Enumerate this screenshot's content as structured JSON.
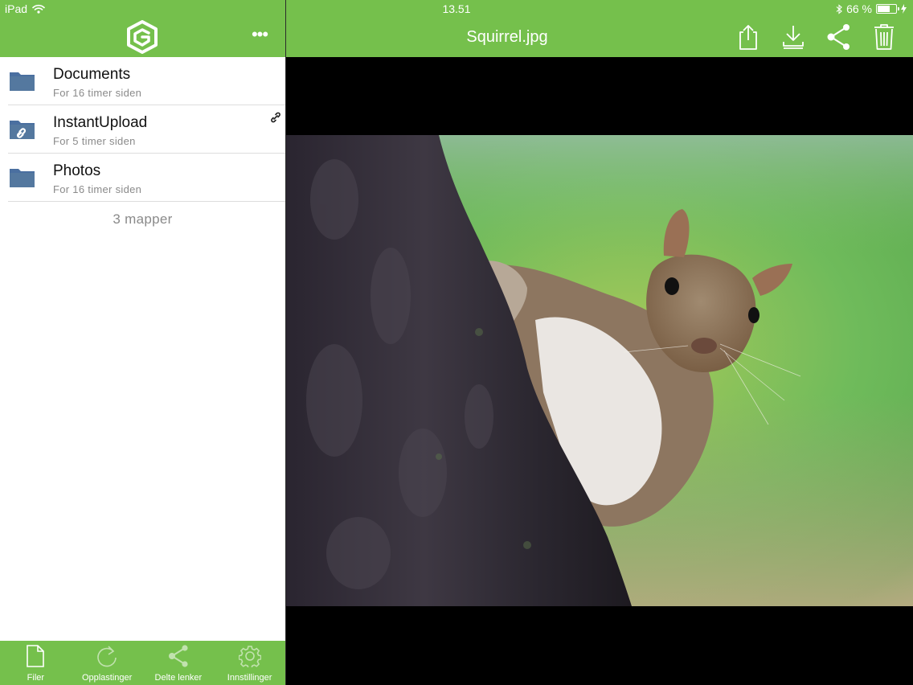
{
  "status_bar": {
    "device": "iPad",
    "time": "13.51",
    "battery": "66 %",
    "battery_level": 0.66
  },
  "sidebar": {
    "items": [
      {
        "name": "Documents",
        "meta": "For 16 timer siden",
        "icon": "folder-icon"
      },
      {
        "name": "InstantUpload",
        "meta": "For 5 timer siden",
        "icon": "shared-folder-icon",
        "badge": "link-icon"
      },
      {
        "name": "Photos",
        "meta": "For 16 timer siden",
        "icon": "folder-icon"
      }
    ],
    "footer": "3 mapper"
  },
  "tabs": [
    {
      "label": "Filer",
      "icon": "file-icon"
    },
    {
      "label": "Opplastinger",
      "icon": "refresh-icon"
    },
    {
      "label": "Delte lenker",
      "icon": "share-icon"
    },
    {
      "label": "Innstillinger",
      "icon": "gear-icon"
    }
  ],
  "viewer": {
    "title": "Squirrel.jpg",
    "actions": [
      "upload-icon",
      "download-icon",
      "share-icon",
      "trash-icon"
    ]
  },
  "colors": {
    "accent": "#75c04c",
    "folder": "#4a6fa0",
    "muted_text": "#8a8a8a"
  }
}
